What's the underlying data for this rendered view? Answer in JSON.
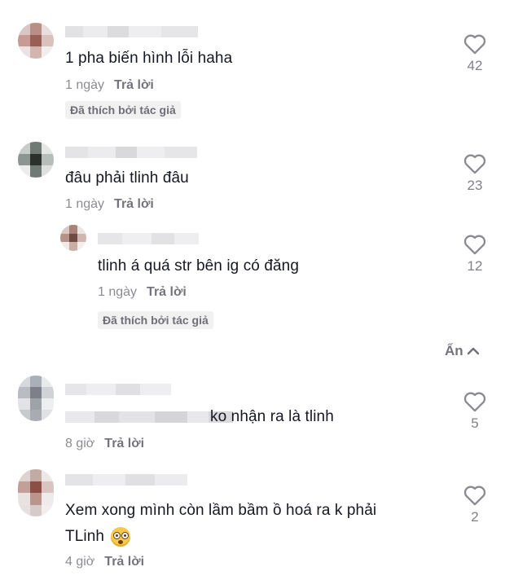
{
  "comments": [
    {
      "text": "1 pha biến hình lỗi haha",
      "time": "1 ngày",
      "reply": "Trả lời",
      "badge": "Đã thích bởi tác giả",
      "likes": "42"
    },
    {
      "text": "đâu phải tlinh đâu",
      "time": "1 ngày",
      "reply": "Trả lời",
      "likes": "23",
      "replies": [
        {
          "text": "tlinh á quá str bên ig có đăng",
          "time": "1 ngày",
          "reply": "Trả lời",
          "badge": "Đã thích bởi tác giả",
          "likes": "12"
        }
      ]
    },
    {
      "text": "ko nhận ra là tlinh",
      "time": "8 giờ",
      "reply": "Trả lời",
      "likes": "5"
    },
    {
      "text_line1": "Xem xong mình còn lầm bầm ồ hoá ra k phải",
      "text_line2": "TLinh",
      "time": "4 giờ",
      "reply": "Trả lời",
      "likes": "2"
    }
  ],
  "hide_replies_label": "Ẩn",
  "icons": {
    "like": "heart-outline-icon",
    "hide": "chevron-up-icon",
    "emoji": "flushed-face-emoji"
  },
  "colors": {
    "text": "#161823",
    "meta": "#8a8b91",
    "badge_bg": "#f1f1f2"
  }
}
